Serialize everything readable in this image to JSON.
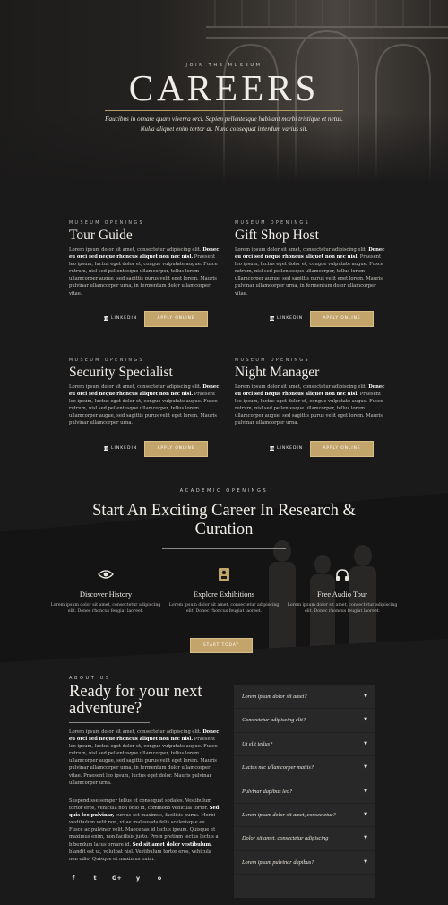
{
  "hero": {
    "eyebrow": "JOIN THE MUSEUM",
    "title": "CAREERS",
    "subtitle": "Faucibus in ornare quam viverra orci. Sapien pellentesque habitant morbi tristique et netus. Nulla aliquet enim tortor at. Nunc consequat interdum varius sit."
  },
  "jobs": [
    {
      "eyebrow": "MUSEUM OPENINGS",
      "title": "Tour Guide",
      "text_plain1": "Lorem ipsum dolor sit amet, consectetur adipiscing elit. ",
      "text_bold": "Donec eu orci sed neque rhoncus aliquet non nec nisl.",
      "text_plain2": " Praesent leo ipsum, luctus eget dolor et, congue vulputate augue. Fusce rutrum, nisl sed pellentesque ullamcorper, tellus lorem ullamcorper augue, sed sagittis purus velit eget lorem. Mauris pulvinar ullamcorper urna, in fermentum dolor ullamcorper vitae.",
      "linkedin_label": "LINKEDIN",
      "apply_label": "APPLY ONLINE"
    },
    {
      "eyebrow": "MUSEUM OPENINGS",
      "title": "Gift Shop Host",
      "text_plain1": "Lorem ipsum dolor sit amet, consectetur adipiscing elit. ",
      "text_bold": "Donec eu orci sed neque rhoncus aliquet non nec nisl.",
      "text_plain2": " Praesent leo ipsum, luctus eget dolor et, congue vulputate augue. Fusce rutrum, nisl sed pellentesque ullamcorper, tellus lorem ullamcorper augue, sed sagittis purus velit eget lorem. Mauris pulvinar ullamcorper urna, in fermentum dolor ullamcorper vitae.",
      "linkedin_label": "LINKEDIN",
      "apply_label": "APPLY ONLINE"
    },
    {
      "eyebrow": "MUSEUM OPENINGS",
      "title": "Security Specialist",
      "text_plain1": "Lorem ipsum dolor sit amet, consectetur adipiscing elit. ",
      "text_bold": "Donec eu orci sed neque rhoncus aliquet non nec nisl.",
      "text_plain2": " Praesent leo ipsum, luctus eget dolor et, congue vulputate augue. Fusce rutrum, nisl sed pellentesque ullamcorper, tellus lorem ullamcorper augue, sed sagittis purus velit eget lorem. Mauris pulvinar ullamcorper urna.",
      "linkedin_label": "LINKEDIN",
      "apply_label": "APPLY ONLINE"
    },
    {
      "eyebrow": "MUSEUM OPENINGS",
      "title": "Night Manager",
      "text_plain1": "Lorem ipsum dolor sit amet, consectetur adipiscing elit. ",
      "text_bold": "Donec eu orci sed neque rhoncus aliquet non nec nisl.",
      "text_plain2": " Praesent leo ipsum, luctus eget dolor et, congue vulputate augue. Fusce rutrum, nisl sed pellentesque ullamcorper, tellus lorem ullamcorper augue, sed sagittis purus velit eget lorem. Mauris pulvinar ullamcorper urna.",
      "linkedin_label": "LINKEDIN",
      "apply_label": "APPLY ONLINE"
    }
  ],
  "academic": {
    "eyebrow": "ACADEMIC OPENINGS",
    "title": "Start An Exciting Career In Research & Curation",
    "features": [
      {
        "icon": "eye-icon",
        "title": "Discover History",
        "text": "Lorem ipsum dolor sit amet, consectetur adipiscing elit. Donec rhoncus feugiat laoreet."
      },
      {
        "icon": "exhibit-icon",
        "title": "Explore Exhibitions",
        "text": "Lorem ipsum dolor sit amet, consectetur adipiscing elit. Donec rhoncus feugiat laoreet."
      },
      {
        "icon": "headphones-icon",
        "title": "Free Audio Tour",
        "text": "Lorem ipsum dolor sit amet, consectetur adipiscing elit. Donec rhoncus feugiat laoreet."
      }
    ],
    "button_label": "START TODAY"
  },
  "about": {
    "eyebrow": "ABOUT US",
    "title": "Ready for your next adventure?",
    "p1_plain1": "Lorem ipsum dolor sit amet, consectetur adipiscing elit. ",
    "p1_bold": "Donec eu orci sed neque rhoncus aliquet non nec nisl.",
    "p1_plain2": " Praesent leo ipsum, luctus eget dolor et, congue vulputate augue. Fusce rutrum, nisl sed pellentesque ullamcorper, tellus lorem ullamcorper augue, sed sagittis purus velit eget lorem. Mauris pulvinar ullamcorper urna, in fermentum dolor ullamcorper vitae. Praesent leo ipsum, luctus eget dolor. Mauris pulvinar ullamcorper urna.",
    "p2_plain1": "Suspendisse semper tellus et consequat sodales. Vestibulum tortor eros, vehicula non odio id, commodo vehicula tortor. ",
    "p2_bold1": "Sed quis leo pulvinar,",
    "p2_plain2": " cursus est maximus, facilisis purus. Morbi vestibulum velit non, vitae malesuada felis scelerisque eu. Fusce ac pulvinar velit. Maecenas id luctus ipsum. Quisque et maximus enim, non facilisis justo. Proin pretium lectus lectus a bibendum lacus ornare id. ",
    "p2_bold2": "Sed sit amet dolor vestibulum,",
    "p2_plain3": " blandit est ut, volutpat nisl. Vestibulum tortor eros, vehicula non odio. Quisque et maximus enim.",
    "social": [
      "f",
      "t",
      "G+",
      "y",
      "o"
    ]
  },
  "faq": [
    "Lorem ipsum dolor sit amet?",
    "Consectetur adipiscing elit?",
    "Ut elit tellus?",
    "Luctus nec ullamcorper mattis?",
    "Pulvinar dapibus leo?",
    "Lorem ipsum dolor sit amet, consectetur?",
    "Dolor sit amet, consectetur adipiscing",
    "Lorem ipsum pulvinar dapibus?"
  ],
  "colors": {
    "accent": "#c3a46a",
    "background": "#1b1a1a",
    "faq_bg": "#292828"
  }
}
